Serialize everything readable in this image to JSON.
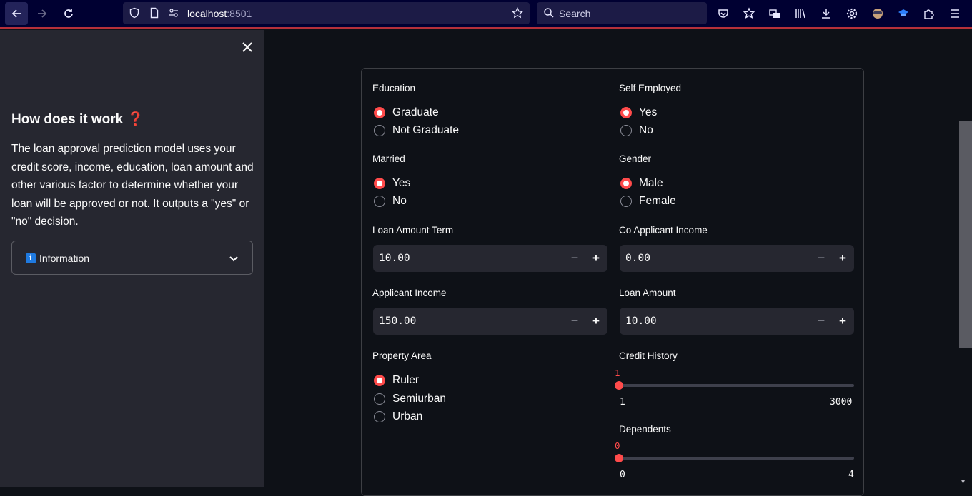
{
  "browser": {
    "url_host": "localhost",
    "url_port": ":8501",
    "search_placeholder": "Search"
  },
  "sidebar": {
    "title": "How does it work ❓",
    "description": "The loan approval prediction model uses your credit score, income, education, loan amount and other various factor to determine whether your loan will be approved or not. It outputs a \"yes\" or \"no\" decision.",
    "expander_label": "Information",
    "info_icon_glyph": "i"
  },
  "form": {
    "education": {
      "label": "Education",
      "options": [
        "Graduate",
        "Not Graduate"
      ],
      "selected": "Graduate"
    },
    "self_employed": {
      "label": "Self Employed",
      "options": [
        "Yes",
        "No"
      ],
      "selected": "Yes"
    },
    "married": {
      "label": "Married",
      "options": [
        "Yes",
        "No"
      ],
      "selected": "Yes"
    },
    "gender": {
      "label": "Gender",
      "options": [
        "Male",
        "Female"
      ],
      "selected": "Male"
    },
    "loan_amount_term": {
      "label": "Loan Amount Term",
      "value": "10.00"
    },
    "co_applicant_income": {
      "label": "Co Applicant Income",
      "value": "0.00"
    },
    "applicant_income": {
      "label": "Applicant Income",
      "value": "150.00"
    },
    "loan_amount": {
      "label": "Loan Amount",
      "value": "10.00"
    },
    "property_area": {
      "label": "Property Area",
      "options": [
        "Ruler",
        "Semiurban",
        "Urban"
      ],
      "selected": "Ruler"
    },
    "credit_history": {
      "label": "Credit History",
      "value": "1",
      "min": "1",
      "max": "3000",
      "fraction": 0
    },
    "dependents": {
      "label": "Dependents",
      "value": "0",
      "min": "0",
      "max": "4",
      "fraction": 0
    },
    "minus_glyph": "−",
    "plus_glyph": "+"
  }
}
